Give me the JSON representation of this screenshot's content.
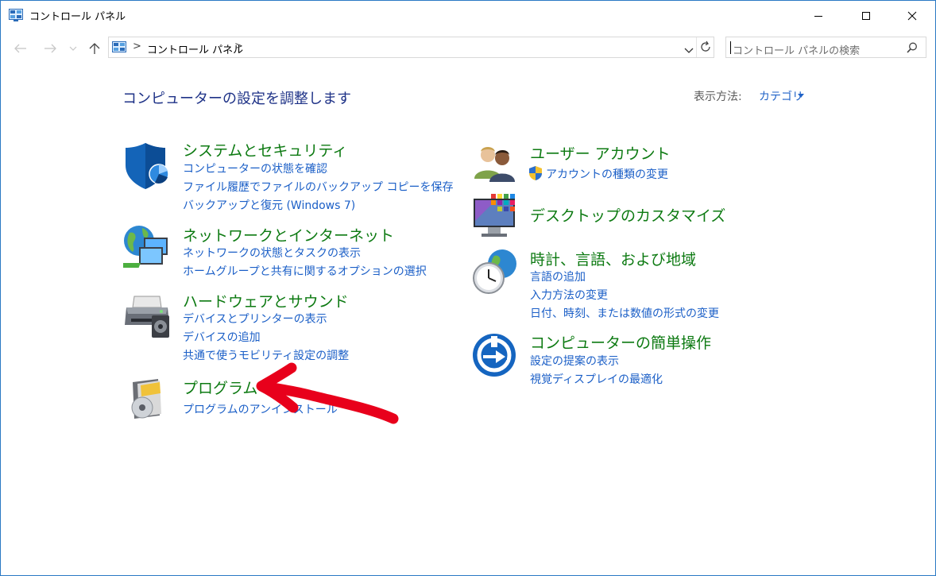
{
  "window": {
    "title": "コントロール パネル"
  },
  "address": {
    "path_label": "コントロール パネル",
    "separator": ">"
  },
  "search": {
    "placeholder": "コントロール パネルの検索"
  },
  "header": {
    "heading": "コンピューターの設定を調整します",
    "view_by_label": "表示方法:",
    "view_by_value": "カテゴリ"
  },
  "categories": {
    "system_security": {
      "title": "システムとセキュリティ",
      "links": [
        "コンピューターの状態を確認",
        "ファイル履歴でファイルのバックアップ コピーを保存",
        "バックアップと復元 (Windows 7)"
      ]
    },
    "network": {
      "title": "ネットワークとインターネット",
      "links": [
        "ネットワークの状態とタスクの表示",
        "ホームグループと共有に関するオプションの選択"
      ]
    },
    "hardware": {
      "title": "ハードウェアとサウンド",
      "links": [
        "デバイスとプリンターの表示",
        "デバイスの追加",
        "共通で使うモビリティ設定の調整"
      ]
    },
    "programs": {
      "title": "プログラム",
      "links": [
        "プログラムのアンインストール"
      ]
    },
    "user_accounts": {
      "title": "ユーザー アカウント",
      "links": [
        "アカウントの種類の変更"
      ]
    },
    "desktop": {
      "title": "デスクトップのカスタマイズ",
      "links": []
    },
    "clock_region": {
      "title": "時計、言語、および地域",
      "links": [
        "言語の追加",
        "入力方法の変更",
        "日付、時刻、または数値の形式の変更"
      ]
    },
    "ease_of_access": {
      "title": "コンピューターの簡単操作",
      "links": [
        "設定の提案の表示",
        "視覚ディスプレイの最適化"
      ]
    }
  },
  "colors": {
    "category_title": "#0d7a12",
    "link": "#1b5fc7",
    "heading": "#1e3287",
    "annotation_arrow": "#e8001b"
  }
}
